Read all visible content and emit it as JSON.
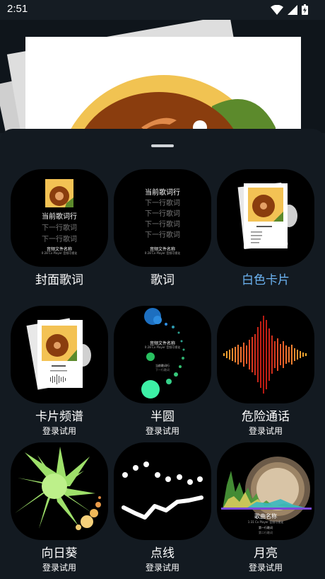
{
  "status": {
    "time": "2:51"
  },
  "tiles": [
    {
      "label": "封面歌词",
      "active": false,
      "sub": "",
      "preview": {
        "current": "当前歌词行",
        "next": [
          "下一行歌词",
          "下一行歌词"
        ],
        "file": "音频文件名称",
        "meta": "0:28 Cx Player 音频可视化"
      }
    },
    {
      "label": "歌词",
      "active": false,
      "sub": "",
      "preview": {
        "current": "当前歌词行",
        "next": [
          "下一行歌词",
          "下一行歌词",
          "下一行歌词",
          "下一行歌词"
        ],
        "file": "音频文件名称",
        "meta": "0:28 Cx Player 音频可视化"
      }
    },
    {
      "label": "白色卡片",
      "active": true,
      "sub": ""
    },
    {
      "label": "卡片频谱",
      "active": false,
      "sub": "登录试用"
    },
    {
      "label": "半圆",
      "active": false,
      "sub": "登录试用",
      "preview": {
        "file": "音频文件名称",
        "meta": "0:28 Cx Player 音频可视化",
        "current": "当前歌词行",
        "next": "下一行歌词"
      }
    },
    {
      "label": "危险通话",
      "active": false,
      "sub": "登录试用"
    },
    {
      "label": "向日葵",
      "active": false,
      "sub": "登录试用"
    },
    {
      "label": "点线",
      "active": false,
      "sub": "登录试用"
    },
    {
      "label": "月亮",
      "active": false,
      "sub": "登录试用",
      "preview": {
        "title": "歌曲名称",
        "meta": "1:31 Cx Player 音频可视化",
        "next": "第一行歌词",
        "next2": "第二行歌词"
      }
    }
  ]
}
